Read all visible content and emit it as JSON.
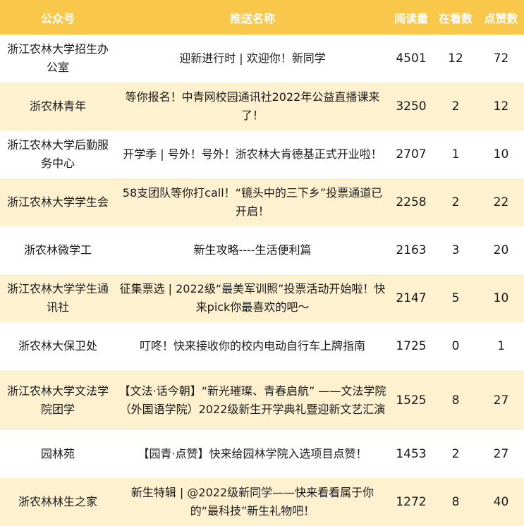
{
  "headers": [
    "公众号",
    "推送名称",
    "阅读量",
    "在看数",
    "点赞数"
  ],
  "rows": [
    {
      "account": "浙江农林大学招生办公室",
      "title": "迎新进行时 | 欢迎你！新同学",
      "reads": "4501",
      "watching": "12",
      "likes": "72"
    },
    {
      "account": "浙农林青年",
      "title": "等你报名！中青网校园通讯社2022年公益直播课来了！",
      "reads": "3250",
      "watching": "2",
      "likes": "12"
    },
    {
      "account": "浙江农林大学后勤服务中心",
      "title": "开学季 | 号外！号外！浙农林大肯德基正式开业啦！",
      "reads": "2707",
      "watching": "1",
      "likes": "10"
    },
    {
      "account": "浙江农林大学学生会",
      "title": "58支团队等你打call！“镜头中的三下乡”投票通道已开启！",
      "reads": "2258",
      "watching": "2",
      "likes": "22"
    },
    {
      "account": "浙农林微学工",
      "title": "新生攻略----生活便利篇",
      "reads": "2163",
      "watching": "3",
      "likes": "20"
    },
    {
      "account": "浙江农林大学学生通讯社",
      "title": "征集票选 | 2022级“最美军训照”投票活动开始啦！快来pick你最喜欢的吧～",
      "reads": "2147",
      "watching": "5",
      "likes": "10"
    },
    {
      "account": "浙农林大保卫处",
      "title": "叮咚！快来接收你的校内电动自行车上牌指南",
      "reads": "1725",
      "watching": "0",
      "likes": "1"
    },
    {
      "account": "浙江农林大学文法学院团学",
      "title": "【文法·话今朝】“新光璀璨、青春启航” ——文法学院（外国语学院）2022级新生开学典礼暨迎新文艺汇演",
      "reads": "1525",
      "watching": "8",
      "likes": "27"
    },
    {
      "account": "园林苑",
      "title": "【园青·点赞】快来给园林学院入选项目点赞！",
      "reads": "1453",
      "watching": "2",
      "likes": "27"
    },
    {
      "account": "浙农林林生之家",
      "title": "新生特辑 | @2022级新同学——快来看看属于你的“最科技”新生礼物吧！",
      "reads": "1272",
      "watching": "8",
      "likes": "40"
    }
  ]
}
